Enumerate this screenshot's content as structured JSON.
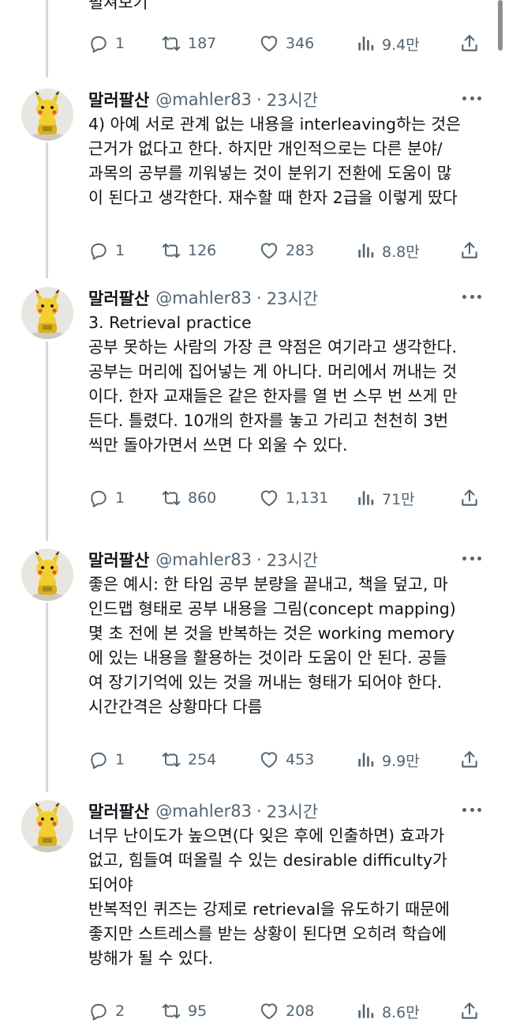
{
  "top_partial": {
    "text": "펼쳐보기",
    "stats": {
      "replies": "1",
      "retweets": "187",
      "likes": "346",
      "views": "9.4만"
    }
  },
  "icons": {
    "reply": "reply-icon",
    "retweet": "retweet-icon",
    "like": "heart-icon",
    "views": "views-icon",
    "share": "share-icon",
    "more": "more-icon"
  },
  "colors": {
    "text": "#0f1419",
    "muted": "#536471",
    "thread_line": "#cfd9de"
  },
  "tweets": [
    {
      "name": "말러팔산",
      "handle": "@mahler83",
      "time": "23시간",
      "lines": [
        "4) 아예 서로 관계 없는 내용을 interleaving하는 것은",
        "근거가 없다고 한다. 하지만 개인적으로는 다른 분야/",
        "과목의 공부를 끼워넣는 것이 분위기 전환에 도움이 많",
        "이 된다고 생각한다. 재수할 때 한자 2급을 이렇게 땄다"
      ],
      "replies": "1",
      "retweets": "126",
      "likes": "283",
      "views": "8.8만"
    },
    {
      "name": "말러팔산",
      "handle": "@mahler83",
      "time": "23시간",
      "lines": [
        "3. Retrieval practice",
        "공부 못하는 사람의 가장 큰 약점은 여기라고 생각한다.",
        "공부는 머리에 집어넣는 게 아니다. 머리에서 꺼내는 것",
        "이다. 한자 교재들은 같은 한자를 열 번 스무 번 쓰게 만",
        "든다. 틀렸다. 10개의 한자를 놓고 가리고 천천히 3번",
        "씩만 돌아가면서 쓰면 다 외울 수 있다."
      ],
      "replies": "1",
      "retweets": "860",
      "likes": "1,131",
      "views": "71만"
    },
    {
      "name": "말러팔산",
      "handle": "@mahler83",
      "time": "23시간",
      "lines": [
        "좋은 예시: 한 타임 공부 분량을 끝내고, 책을 덮고, 마",
        "인드맵 형태로 공부 내용을 그림(concept mapping)",
        "몇 초 전에 본 것을 반복하는 것은 working memory",
        "에 있는 내용을 활용하는 것이라 도움이 안 된다. 공들",
        "여 장기기억에 있는 것을 꺼내는 형태가 되어야 한다.",
        "시간간격은 상황마다 다름"
      ],
      "replies": "1",
      "retweets": "254",
      "likes": "453",
      "views": "9.9만"
    },
    {
      "name": "말러팔산",
      "handle": "@mahler83",
      "time": "23시간",
      "lines": [
        "너무 난이도가 높으면(다 잊은 후에 인출하면) 효과가",
        "없고, 힘들여 떠올릴 수 있는 desirable difficulty가",
        "되어야",
        "반복적인 퀴즈는 강제로 retrieval을 유도하기 때문에",
        "좋지만 스트레스를 받는 상황이 된다면 오히려 학습에",
        "방해가 될 수 있다."
      ],
      "replies": "2",
      "retweets": "95",
      "likes": "208",
      "views": "8.6만"
    }
  ]
}
